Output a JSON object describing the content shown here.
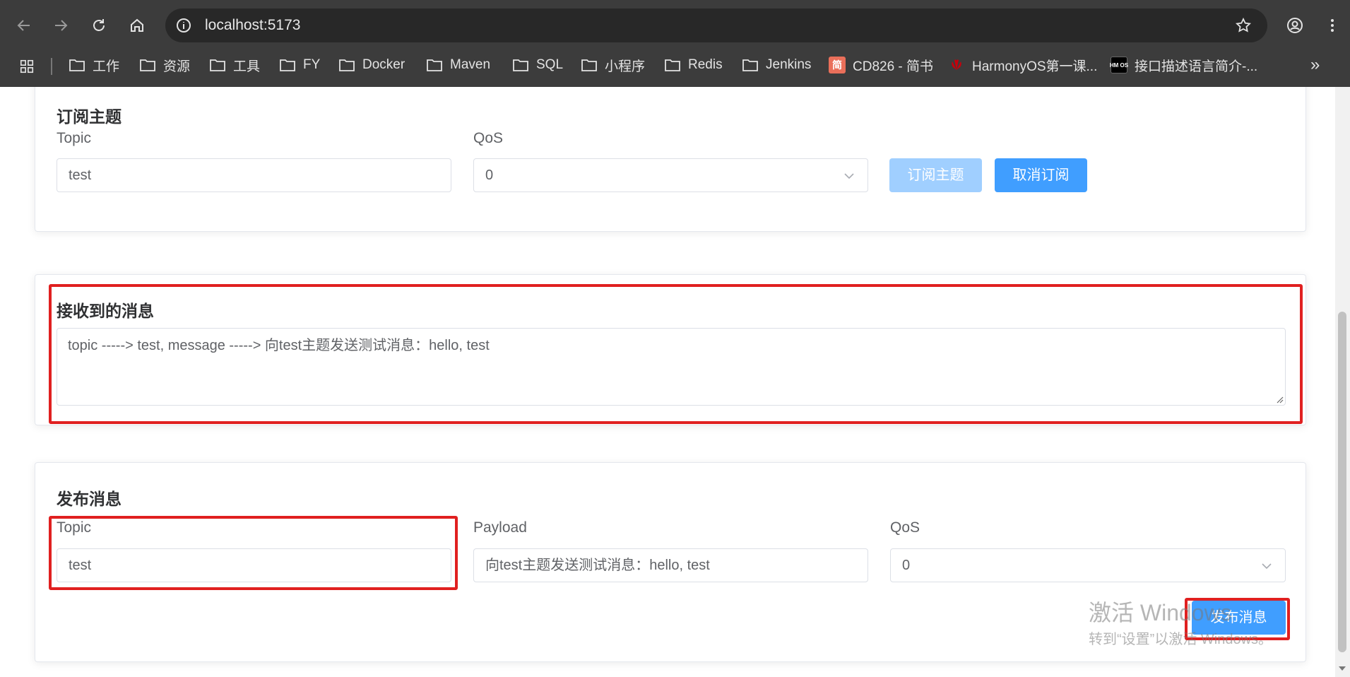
{
  "browser": {
    "url": "localhost:5173",
    "bookmarks": [
      {
        "label": "工作",
        "type": "folder"
      },
      {
        "label": "资源",
        "type": "folder"
      },
      {
        "label": "工具",
        "type": "folder"
      },
      {
        "label": "FY",
        "type": "folder"
      },
      {
        "label": "Docker",
        "type": "folder"
      },
      {
        "label": "Maven",
        "type": "folder"
      },
      {
        "label": "SQL",
        "type": "folder"
      },
      {
        "label": "小程序",
        "type": "folder"
      },
      {
        "label": "Redis",
        "type": "folder"
      },
      {
        "label": "Jenkins",
        "type": "folder"
      },
      {
        "label": "CD826 - 简书",
        "type": "site",
        "favicon_text": "简",
        "favicon_color": "#ea6f5a"
      },
      {
        "label": "HarmonyOS第一课...",
        "type": "site",
        "favicon_color": "#c7000b"
      },
      {
        "label": "接口描述语言简介-...",
        "type": "site",
        "favicon_text": "HM OS",
        "favicon_color": "#000000"
      }
    ],
    "more_bookmarks": "»"
  },
  "subscribe": {
    "title": "订阅主题",
    "topic_label": "Topic",
    "topic_value": "test",
    "qos_label": "QoS",
    "qos_value": "0",
    "subscribe_button": "订阅主题",
    "unsubscribe_button": "取消订阅"
  },
  "received": {
    "title": "接收到的消息",
    "message": "topic -----> test, message -----> 向test主题发送测试消息：hello, test"
  },
  "publish": {
    "title": "发布消息",
    "topic_label": "Topic",
    "topic_value": "test",
    "payload_label": "Payload",
    "payload_value": "向test主题发送测试消息：hello, test",
    "qos_label": "QoS",
    "qos_value": "0",
    "publish_button": "发布消息"
  },
  "watermark": {
    "line1": "激活 Windows",
    "line2": "转到“设置”以激活 Windows。"
  },
  "colors": {
    "primary": "#409eff",
    "primary_disabled": "#a0cfff",
    "highlight": "#e02020",
    "chrome_bg": "#3c3c3c"
  }
}
